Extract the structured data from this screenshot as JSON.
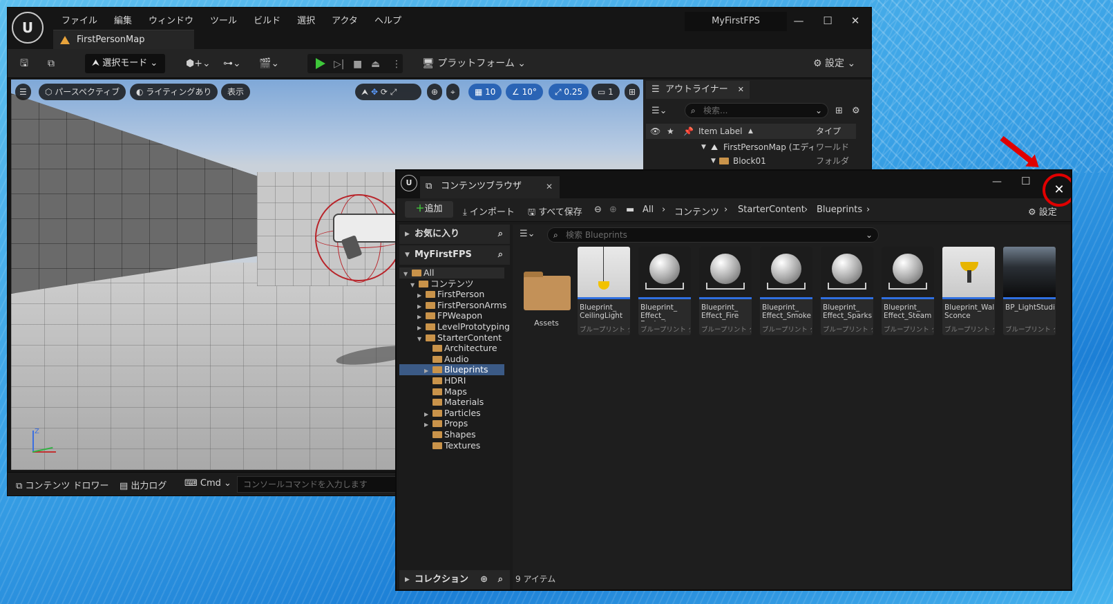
{
  "main_window": {
    "logo": "U",
    "menu": [
      "ファイル",
      "編集",
      "ウィンドウ",
      "ツール",
      "ビルド",
      "選択",
      "アクタ",
      "ヘルプ"
    ],
    "map_tab": "FirstPersonMap",
    "project_name": "MyFirstFPS",
    "toolbar": {
      "select_mode": "選択モード",
      "platform": "プラットフォーム",
      "settings": "設定"
    },
    "viewport": {
      "perspective": "パースペクティブ",
      "lighting": "ライティングあり",
      "show": "表示",
      "grid_snap": "10",
      "angle_snap": "10°",
      "scale_snap": "0.25",
      "camera_speed": "1",
      "axis_label": "Z"
    },
    "bottom": {
      "content_drawer": "コンテンツ ドロワー",
      "output_log": "出力ログ",
      "cmd": "Cmd",
      "console_placeholder": "コンソールコマンドを入力します"
    }
  },
  "outliner": {
    "tab": "アウトライナー",
    "search_placeholder": "検索...",
    "col_label": "Item Label",
    "col_type": "タイプ",
    "rows": [
      {
        "label": "FirstPersonMap (エディ",
        "type": "ワールド"
      },
      {
        "label": "Block01",
        "type": "フォルダ"
      }
    ]
  },
  "content_browser": {
    "tab": "コンテンツブラウザ",
    "toolbar": {
      "add": "追加",
      "import": "インポート",
      "save_all": "すべて保存",
      "settings": "設定"
    },
    "breadcrumb": [
      "All",
      "コンテンツ",
      "StarterContent",
      "Blueprints"
    ],
    "sidebar": {
      "favorites": "お気に入り",
      "project": "MyFirstFPS",
      "collections": "コレクション",
      "tree": [
        {
          "label": "All",
          "depth": 0,
          "open": true
        },
        {
          "label": "コンテンツ",
          "depth": 1,
          "open": true
        },
        {
          "label": "FirstPerson",
          "depth": 2,
          "arrow": true
        },
        {
          "label": "FirstPersonArms",
          "depth": 2,
          "arrow": true
        },
        {
          "label": "FPWeapon",
          "depth": 2,
          "arrow": true
        },
        {
          "label": "LevelPrototyping",
          "depth": 2,
          "arrow": true
        },
        {
          "label": "StarterContent",
          "depth": 2,
          "open": true
        },
        {
          "label": "Architecture",
          "depth": 3
        },
        {
          "label": "Audio",
          "depth": 3
        },
        {
          "label": "Blueprints",
          "depth": 3,
          "arrow": true,
          "selected": true
        },
        {
          "label": "HDRI",
          "depth": 3
        },
        {
          "label": "Maps",
          "depth": 3
        },
        {
          "label": "Materials",
          "depth": 3
        },
        {
          "label": "Particles",
          "depth": 3,
          "arrow": true
        },
        {
          "label": "Props",
          "depth": 3,
          "arrow": true
        },
        {
          "label": "Shapes",
          "depth": 3
        },
        {
          "label": "Textures",
          "depth": 3
        }
      ]
    },
    "search_placeholder": "検索 Blueprints",
    "folder_asset": "Assets",
    "assets": [
      {
        "name": "Blueprint_ CeilingLight",
        "type": "ブループリント ク...",
        "thumb": "lamp"
      },
      {
        "name": "Blueprint_ Effect_ Explosion",
        "type": "ブループリント ク...",
        "thumb": "sphere"
      },
      {
        "name": "Blueprint_ Effect_Fire",
        "type": "ブループリント ク...",
        "thumb": "sphere"
      },
      {
        "name": "Blueprint_ Effect_Smoke",
        "type": "ブループリント ク...",
        "thumb": "sphere"
      },
      {
        "name": "Blueprint_ Effect_Sparks",
        "type": "ブループリント ク...",
        "thumb": "sphere"
      },
      {
        "name": "Blueprint_ Effect_Steam",
        "type": "ブループリント ク...",
        "thumb": "sphere"
      },
      {
        "name": "Blueprint_Wall Sconce",
        "type": "ブループリント ク...",
        "thumb": "sconce"
      },
      {
        "name": "BP_LightStudio",
        "type": "ブループリント ク...",
        "thumb": "studio"
      }
    ],
    "item_count": "9 アイテム"
  },
  "colors": {
    "accent_blue": "#2f6fe0",
    "play_green": "#3ec73a",
    "highlight_red": "#e00000",
    "folder": "#c9934a"
  }
}
